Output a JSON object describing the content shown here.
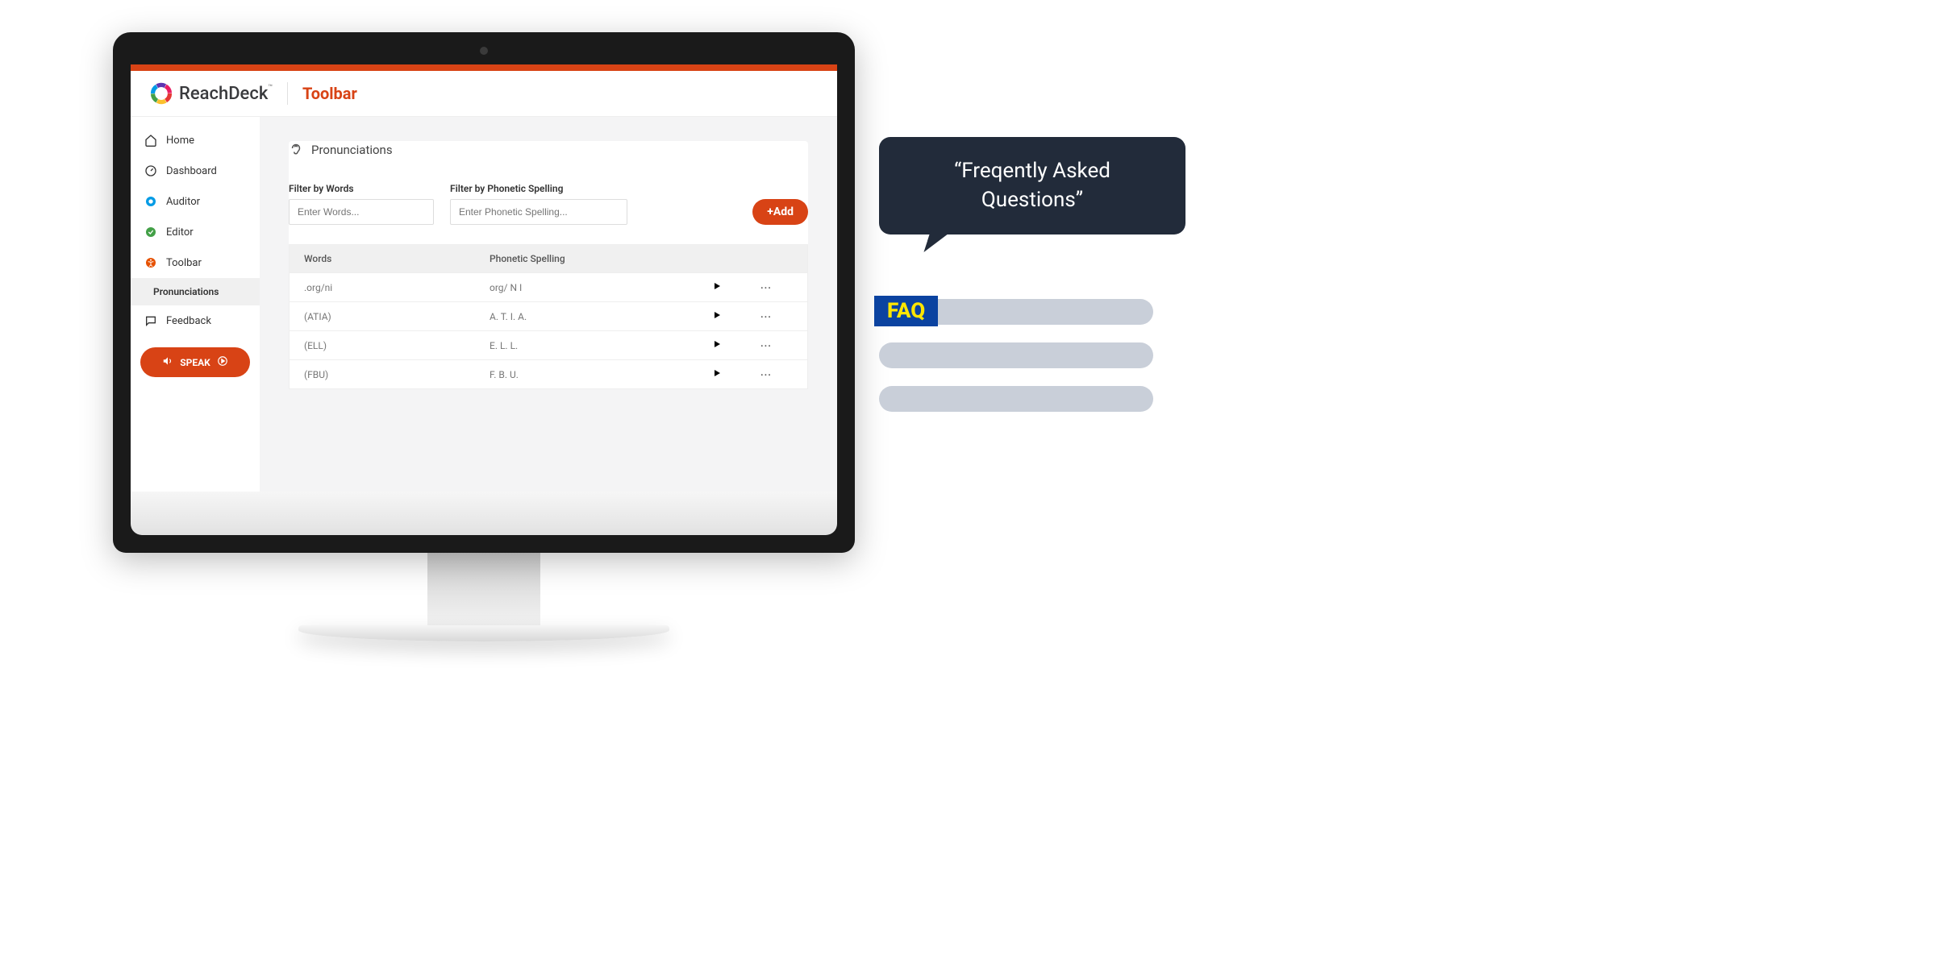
{
  "brand": {
    "name": "ReachDeck",
    "tm": "™"
  },
  "section": "Toolbar",
  "nav": {
    "home": "Home",
    "dashboard": "Dashboard",
    "auditor": "Auditor",
    "editor": "Editor",
    "toolbar": "Toolbar",
    "pronunciations": "Pronunciations",
    "feedback": "Feedback",
    "speak": "SPEAK"
  },
  "page": {
    "title": "Pronunciations",
    "filter_words_label": "Filter by Words",
    "filter_words_placeholder": "Enter Words...",
    "filter_phonetic_label": "Filter by Phonetic Spelling",
    "filter_phonetic_placeholder": "Enter Phonetic Spelling...",
    "add_label": "+Add",
    "col_words": "Words",
    "col_phonetic": "Phonetic Spelling"
  },
  "rows": [
    {
      "word": ".org/ni",
      "phonetic": "org/ N I"
    },
    {
      "word": "(ATIA)",
      "phonetic": "A. T. I. A."
    },
    {
      "word": "(ELL)",
      "phonetic": "E. L. L."
    },
    {
      "word": "(FBU)",
      "phonetic": "F. B. U."
    }
  ],
  "illus": {
    "bubble": "“Freqently Asked Questions”",
    "faq": "FAQ"
  }
}
